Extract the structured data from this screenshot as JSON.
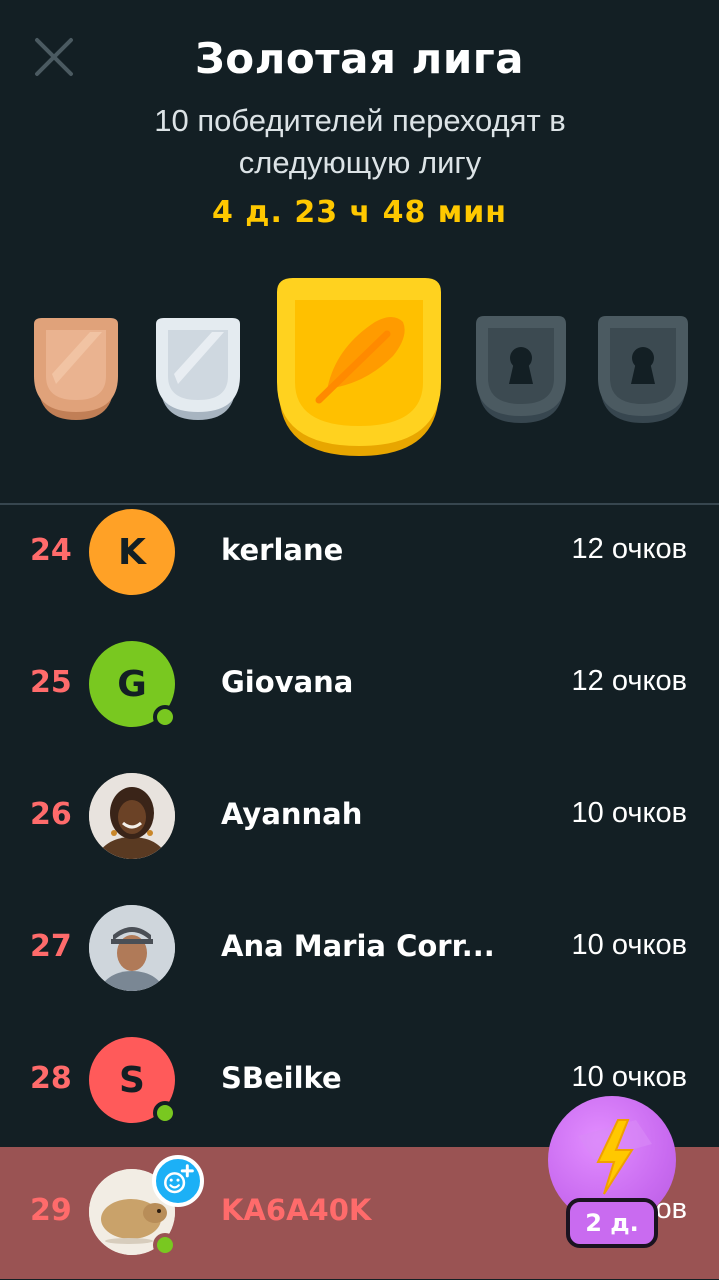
{
  "header": {
    "title": "Золотая лига",
    "subtitle": "10 победителей переходят в следующую лигу",
    "timer": "4 д. 23 ч 48 мин"
  },
  "leagues": [
    {
      "name": "bronze",
      "state": "passed",
      "color": "#e0a27a"
    },
    {
      "name": "silver",
      "state": "passed",
      "color": "#dbe3ea"
    },
    {
      "name": "gold",
      "state": "current",
      "color": "#ffc800",
      "icon": "feather-icon"
    },
    {
      "name": "locked-1",
      "state": "locked",
      "color": "#4b5a61",
      "icon": "keyhole-icon"
    },
    {
      "name": "locked-2",
      "state": "locked",
      "color": "#4b5a61",
      "icon": "keyhole-icon"
    }
  ],
  "leaderboard": [
    {
      "rank": "24",
      "initial": "K",
      "avatar_color": "#ffa126",
      "name": "kerlane",
      "points": "12 очков",
      "online": false
    },
    {
      "rank": "25",
      "initial": "G",
      "avatar_color": "#79c820",
      "name": "Giovana",
      "points": "12 очков",
      "online": true
    },
    {
      "rank": "26",
      "initial": "",
      "avatar_color": "#c9b8a8",
      "name": "Ayannah",
      "points": "10 очков",
      "online": false
    },
    {
      "rank": "27",
      "initial": "",
      "avatar_color": "#b5bcc4",
      "name": "Ana Maria Corr...",
      "points": "10 очков",
      "online": false
    },
    {
      "rank": "28",
      "initial": "S",
      "avatar_color": "#ff5a5a",
      "name": "SBeilke",
      "points": "10 очков",
      "online": true
    },
    {
      "rank": "29",
      "initial": "",
      "avatar_color": "#efe6d8",
      "name": "KA6A40K",
      "points": "10 очков",
      "online": true,
      "current_user": true
    }
  ],
  "boost": {
    "label": "2 д.",
    "icon": "lightning-icon"
  },
  "colors": {
    "background": "#131f24",
    "accent_gold": "#ffc800",
    "rank_red": "#ff6b6b",
    "current_row": "#9a5353",
    "boost_purple": "#c96bf0"
  }
}
